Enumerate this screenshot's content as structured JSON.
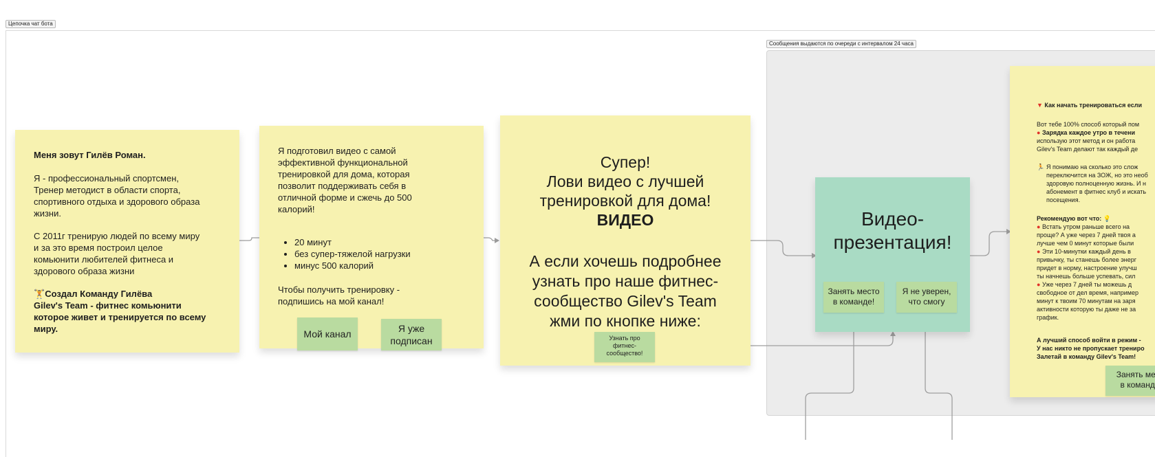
{
  "board": {
    "tag": "Цепочка чат бота",
    "section_tag": "Сообщения выдаются по очереди с интервалом 24 часа"
  },
  "card1": {
    "name": "Меня зовут Гилёв Роман.",
    "p1": "Я - профессиональный спортсмен,\nТренер методист в области спорта,\nспортивного отдыха и здорового образа\nжизни.",
    "p2": "С 2011г тренирую людей по всему миру\nи за это время построил целое\nкомьюнити любителей фитнеса и\nздорового образа жизни",
    "emoji": "🏋️",
    "p3a": "Создал Команду Гилёва",
    "p3b": "Gilev's Team - фитнес комьюнити\nкоторое живет и тренируется по всему\nмиру."
  },
  "card2": {
    "p1": "Я подготовил видео с самой\nэффективной функциональной\nтренировкой для дома, которая\nпозволит поддерживать себя в\nотличной форме и сжечь до 500\nкалорий!",
    "bullets": [
      "20 минут",
      "без супер-тяжелой нагрузки",
      "минус 500 калорий"
    ],
    "p2": "Чтобы получить тренировку -\nподпишись на мой канал!",
    "btn_channel": "Мой канал",
    "btn_subscribed": "Я уже\nподписан"
  },
  "card3": {
    "line1": "Супер!",
    "line2": "Лови видео с лучшей\nтренировкой для дома!",
    "video": "ВИДЕО",
    "p2": "А если хочешь подробнее\nузнать про наше фитнес-\nсообщество Gilev's Team\nжми по кнопке ниже:",
    "btn": "Узнать про\nфитнес-\nсообщество!"
  },
  "card4": {
    "title": "Видео-\nпрезентация!",
    "btn_take": "Занять место\nв команде!",
    "btn_unsure": "Я не уверен,\nчто смогу"
  },
  "card5": {
    "head": "Как начать тренироваться если",
    "p1": "Вот тебе 100% способ который пом",
    "p1b_bold": "Зарядка каждое утро в течени",
    "p1c": "использую этот метод и он работа\nGilev's Team делают так каждый де",
    "p2": "Я понимаю на сколько это слож\nпереключится на ЗОЖ, но это необ\nздоровую полноценную жизнь. И н\nабонемент в фитнес клуб и искать\nпосещения.",
    "rec": "Рекомендую вот что:",
    "r1a": "Встать утром раньше всего на",
    "r1b": "проще? А уже через 7 дней твоя а\nлучше чем 0 минут которые были",
    "r2a": "Эти 10-минутки каждый день в",
    "r2b": "привычку, ты станешь более энерг\nпридет в норму, настроение улучш\nты начнешь больше успевать, сил",
    "r3a": "Уже через 7 дней ты можешь д",
    "r3b": "свободное от дел время, например\nминут к твоим 70 минутам на заря\nактивности которую ты даже не за\nграфик.",
    "final": "А лучший способ войти в режим -\nУ нас никто не пропускает трениро\nЗалетай в команду Gilev's Team!",
    "btn": "Занять мест\nв команде"
  },
  "colors": {
    "sticky_yellow": "#f7f2b0",
    "sticky_teal": "#a9dbc4",
    "button_green": "#b9dba0",
    "section_gray": "#ececec",
    "connector": "#9e9e9e",
    "red_dot": "#e0322a"
  }
}
